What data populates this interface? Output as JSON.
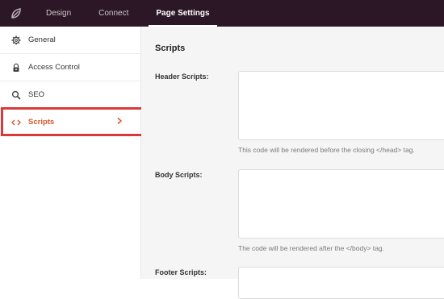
{
  "topbar": {
    "logo_icon": "seedprod-leaf-icon",
    "tabs": [
      {
        "label": "Design"
      },
      {
        "label": "Connect"
      },
      {
        "label": "Page Settings"
      }
    ]
  },
  "sidebar": {
    "items": [
      {
        "label": "General",
        "icon": "gear-icon"
      },
      {
        "label": "Access Control",
        "icon": "lock-icon"
      },
      {
        "label": "SEO",
        "icon": "search-icon"
      },
      {
        "label": "Scripts",
        "icon": "code-icon"
      }
    ]
  },
  "main": {
    "title": "Scripts",
    "fields": [
      {
        "label": "Header Scripts:",
        "help": "This code will be rendered before the closing </head> tag."
      },
      {
        "label": "Body Scripts:",
        "help": "The code will be rendered after the </body> tag."
      },
      {
        "label": "Footer Scripts:",
        "help": ""
      }
    ]
  },
  "colors": {
    "topbar": "#2c1726",
    "active_accent": "#d9572b",
    "highlight": "#d93a3a"
  }
}
